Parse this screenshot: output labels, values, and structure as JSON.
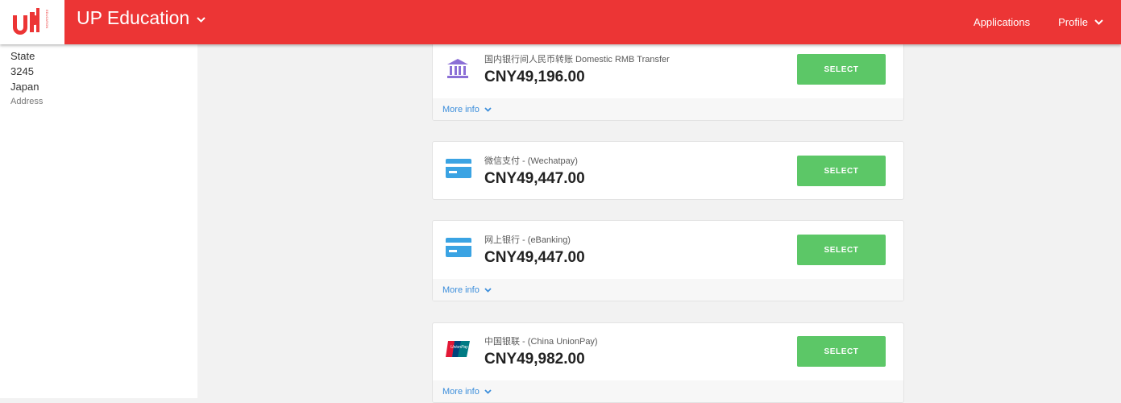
{
  "header": {
    "brand": "UP Education",
    "logo_text": "UP",
    "logo_subtext": "EDUCATION",
    "nav": [
      "Applications",
      "Profile"
    ],
    "color": "#ec3535"
  },
  "address": {
    "lines": [
      "State",
      "3245",
      "Japan"
    ],
    "label": "Address"
  },
  "payment_options": [
    {
      "name": "国内银行间人民币转账 Domestic RMB Transfer",
      "price": "CNY49,196.00",
      "select_label": "SELECT",
      "more_info": "More info",
      "icon": "bank-icon"
    },
    {
      "name": "微信支付 - (Wechatpay)",
      "price": "CNY49,447.00",
      "select_label": "SELECT",
      "icon": "card-icon"
    },
    {
      "name": "网上银行 - (eBanking)",
      "price": "CNY49,447.00",
      "select_label": "SELECT",
      "more_info": "More info",
      "icon": "card-icon"
    },
    {
      "name": "中国银联 - (China UnionPay)",
      "price": "CNY49,982.00",
      "select_label": "SELECT",
      "more_info": "More info",
      "icon": "unionpay-icon"
    }
  ],
  "colors": {
    "select_button": "#5cc767",
    "link": "#3c8edb"
  }
}
